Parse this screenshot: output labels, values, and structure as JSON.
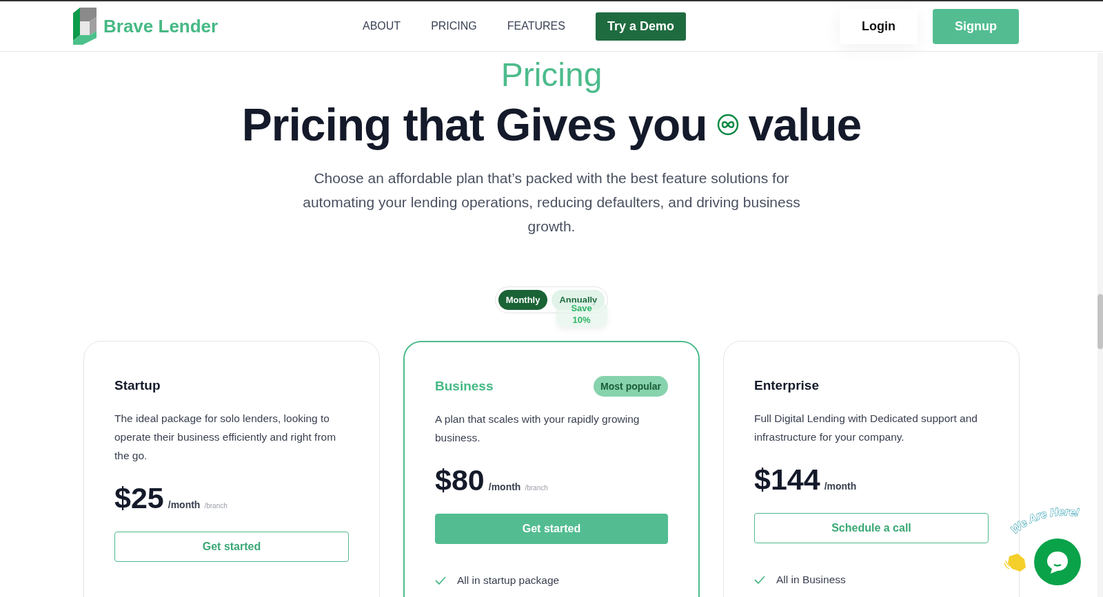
{
  "header": {
    "brand": "Brave Lender",
    "nav": [
      {
        "label": "ABOUT"
      },
      {
        "label": "PRICING"
      },
      {
        "label": "FEATURES"
      }
    ],
    "demo_button": "Try a Demo",
    "login": "Login",
    "signup": "Signup"
  },
  "hero": {
    "eyebrow": "Pricing",
    "title_before": "Pricing that Gives you",
    "title_after": "value",
    "subtitle": "Choose an affordable plan that’s packed with the best feature solutions for automating your lending operations, reducing defaulters, and driving business growth."
  },
  "billing_toggle": {
    "options": [
      {
        "label": "Monthly",
        "selected": true
      },
      {
        "label": "Annually",
        "selected": false
      }
    ],
    "badge": "Save 10%"
  },
  "plans": [
    {
      "name": "Startup",
      "featured": false,
      "description": "The ideal package for solo lenders, looking to operate their business efficiently and right from the go.",
      "price": "$25",
      "period": "/month",
      "unit": "/branch",
      "button": "Get started"
    },
    {
      "name": "Business",
      "featured": true,
      "badge": "Most popular",
      "description": "A plan that scales with your rapidly growing business.",
      "price": "$80",
      "period": "/month",
      "unit": "/branch",
      "button": "Get started",
      "features": [
        "All in startup package"
      ]
    },
    {
      "name": "Enterprise",
      "featured": false,
      "description": "Full Digital Lending with Dedicated support and infrastructure for your company.",
      "price": "$144",
      "period": "/month",
      "button": "Schedule a call",
      "features": [
        "All in Business"
      ]
    }
  ],
  "chat_widget": {
    "label": "We Are Here!"
  }
}
